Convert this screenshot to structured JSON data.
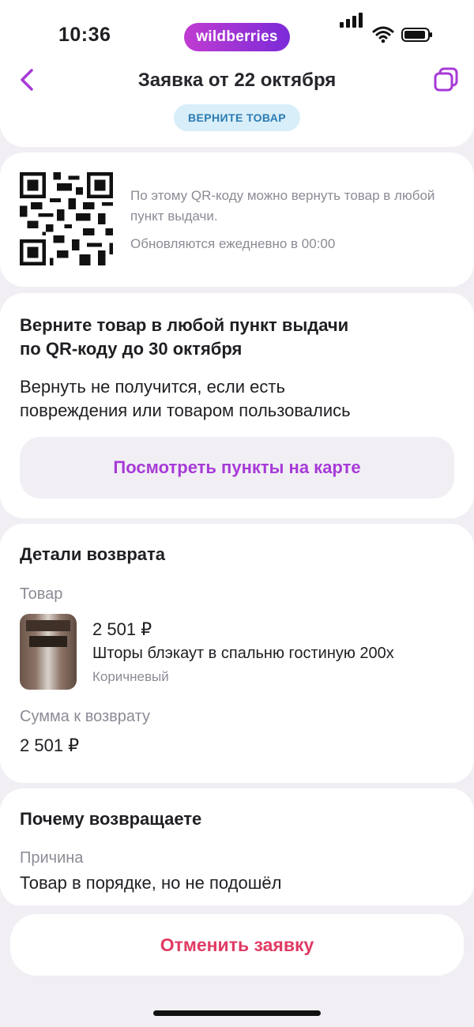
{
  "status": {
    "time": "10:36",
    "brand": "wildberries",
    "icons": [
      "signal-icon",
      "wifi-icon",
      "battery-icon"
    ]
  },
  "header": {
    "title": "Заявка от 22 октября",
    "back_icon": "chevron-left-icon",
    "copy_icon": "copy-icon",
    "badge": "ВЕРНИТЕ ТОВАР"
  },
  "qr": {
    "text": "По этому QR-коду можно вернуть товар в любой пункт выдачи.",
    "update": "Обновляются ежедневно в 00:00"
  },
  "return_info": {
    "heading_line1": "Верните товар в любой пункт выдачи",
    "heading_line2": "по QR-коду до 30 октября",
    "warning_line1": "Вернуть не получится, если есть",
    "warning_line2": "повреждения или товаром пользовались",
    "map_button": "Посмотреть пункты на карте"
  },
  "details": {
    "title": "Детали возврата",
    "product_label": "Товар",
    "product": {
      "price": "2 501 ₽",
      "name": "Шторы блэкаут в спальню гостиную 200x",
      "color": "Коричневый"
    },
    "refund_label": "Сумма к возврату",
    "refund_value": "2 501 ₽"
  },
  "reason": {
    "title": "Почему возвращаете",
    "label": "Причина",
    "value": "Товар в порядке, но не подошёл"
  },
  "actions": {
    "cancel_button": "Отменить заявку"
  },
  "colors": {
    "accent": "#a73ad7",
    "danger": "#e03a63",
    "badge_bg": "#d8eef8",
    "page_bg": "#f1eff4"
  }
}
